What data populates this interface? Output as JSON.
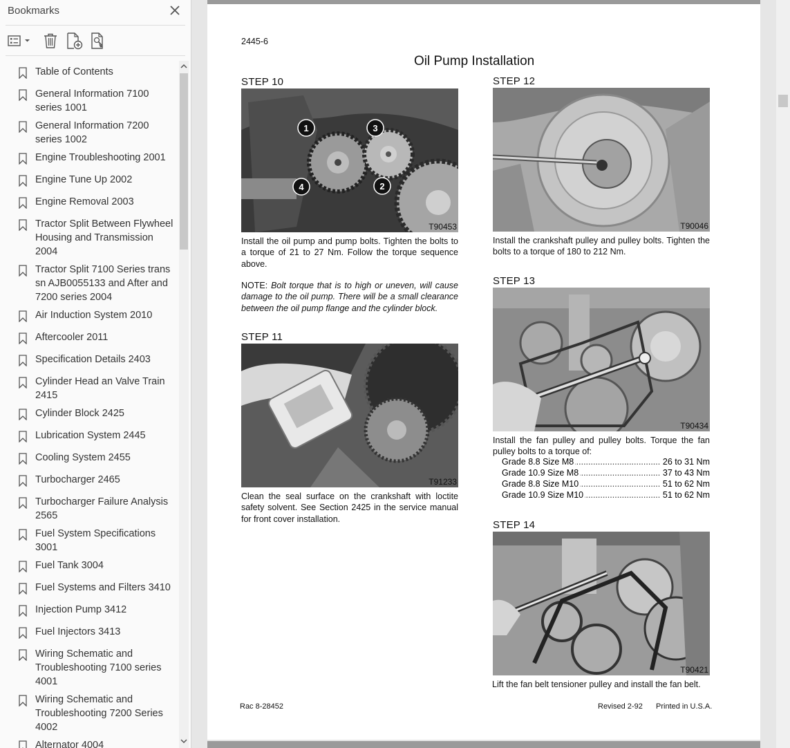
{
  "sidebar": {
    "title": "Bookmarks",
    "items": [
      {
        "label": "Table of Contents"
      },
      {
        "label": "General Information 7100\nseries  1001"
      },
      {
        "label": "General Information 7200\nseries 1002"
      },
      {
        "label": "Engine Troubleshooting 2001"
      },
      {
        "label": "Engine Tune Up 2002"
      },
      {
        "label": "Engine Removal 2003"
      },
      {
        "label": "Tractor Split Between Flywheel\nHousing and Transmission\n2004"
      },
      {
        "label": "Tractor Split 7100 Series trans\nsn AJB0055133 and After and\n7200 series 2004"
      },
      {
        "label": "Air Induction System 2010"
      },
      {
        "label": "Aftercooler 2011"
      },
      {
        "label": "Specification Details 2403"
      },
      {
        "label": "Cylinder Head an Valve Train\n2415"
      },
      {
        "label": "Cylinder Block 2425"
      },
      {
        "label": "Lubrication System 2445"
      },
      {
        "label": "Cooling System 2455"
      },
      {
        "label": "Turbocharger 2465"
      },
      {
        "label": "Turbocharger Failure Analysis\n2565"
      },
      {
        "label": "Fuel System Specifications\n3001"
      },
      {
        "label": "Fuel Tank 3004"
      },
      {
        "label": "Fuel Systems and Filters 3410"
      },
      {
        "label": "Injection Pump 3412"
      },
      {
        "label": "Fuel Injectors 3413"
      },
      {
        "label": "Wiring Schematic and\nTroubleshooting 7100 series\n4001"
      },
      {
        "label": "Wiring Schematic and\nTroubleshooting 7200 Series\n4002"
      },
      {
        "label": "Alternator 4004"
      }
    ]
  },
  "page": {
    "header_code": "2445-6",
    "title": "Oil Pump Installation",
    "steps": {
      "step10": {
        "title": "STEP 10",
        "photo_code": "T90453",
        "callouts": [
          "1",
          "3",
          "4",
          "2"
        ],
        "caption": "Install the oil pump and pump bolts. Tighten the bolts to a torque of 21 to 27 Nm. Follow the torque sequence above.",
        "note_label": "NOTE:",
        "note_text": "Bolt torque that is to high or uneven, will cause damage to the oil pump. There will be a small clearance between the oil pump flange and the cylinder block."
      },
      "step11": {
        "title": "STEP 11",
        "photo_code": "T91233",
        "caption": "Clean the seal surface on the crankshaft with loctite safety solvent. See Section 2425 in the service manual for front cover installation."
      },
      "step12": {
        "title": "STEP 12",
        "photo_code": "T90046",
        "caption": "Install the crankshaft pulley and pulley bolts. Tighten the bolts to a torque of 180 to 212 Nm."
      },
      "step13": {
        "title": "STEP 13",
        "photo_code": "T90434",
        "caption": "Install the fan pulley and pulley bolts. Torque the fan pulley bolts to a torque of:",
        "specs": [
          {
            "label": "Grade 8.8 Size M8",
            "value": "26 to 31 Nm"
          },
          {
            "label": "Grade 10.9 Size M8",
            "value": "37 to 43 Nm"
          },
          {
            "label": "Grade 8.8 Size M10",
            "value": "51 to 62 Nm"
          },
          {
            "label": "Grade 10.9 Size M10",
            "value": "51 to 62 Nm"
          }
        ]
      },
      "step14": {
        "title": "STEP 14",
        "photo_code": "T90421",
        "caption": "Lift the fan belt tensioner pulley and install the fan belt."
      }
    },
    "footer_left": "Rac 8-28452",
    "footer_revised": "Revised 2-92",
    "footer_printed": "Printed in U.S.A."
  }
}
